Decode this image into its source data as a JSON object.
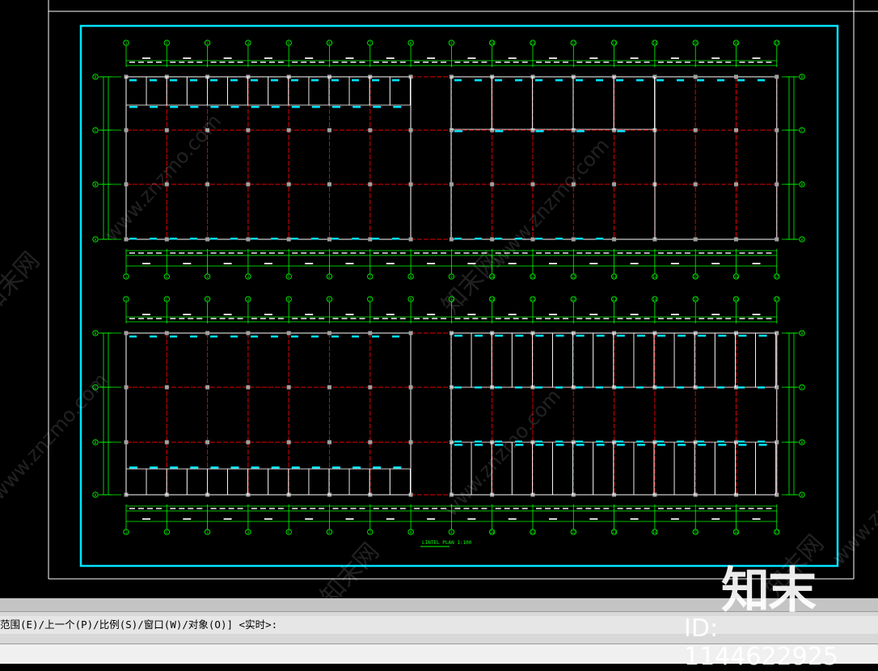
{
  "drawing": {
    "title_label": "LINTEL PLAN 1:100",
    "layout_color": "#00e5ff",
    "grid_color": "#e00000",
    "dim_color": "#00ff00",
    "wall_color": "#ffffff",
    "column_color": "#a0a0a0",
    "top_plan": {
      "axis_numbers": [
        "1",
        "2",
        "3",
        "4",
        "5",
        "6",
        "7",
        "8",
        "9",
        "10",
        "11",
        "12",
        "13",
        "14",
        "15",
        "16",
        "17"
      ],
      "axis_letters": [
        "A",
        "B",
        "C",
        "D"
      ]
    },
    "bottom_plan": {
      "axis_numbers": [
        "1",
        "2",
        "3",
        "4",
        "5",
        "6",
        "7",
        "8",
        "9",
        "10",
        "11",
        "12",
        "13",
        "14",
        "15",
        "16",
        "17"
      ],
      "axis_letters": [
        "A",
        "B",
        "C",
        "D"
      ]
    }
  },
  "command_bar": {
    "prompt_text": "范围(E)/上一个(P)/比例(S)/窗口(W)/对象(O)] <实时>:",
    "input_value": ""
  },
  "watermark": {
    "site_text": "www.znzmo.com",
    "brand_text": "知末网",
    "logo_text": "知末",
    "id_text": "ID: 1144622925"
  }
}
